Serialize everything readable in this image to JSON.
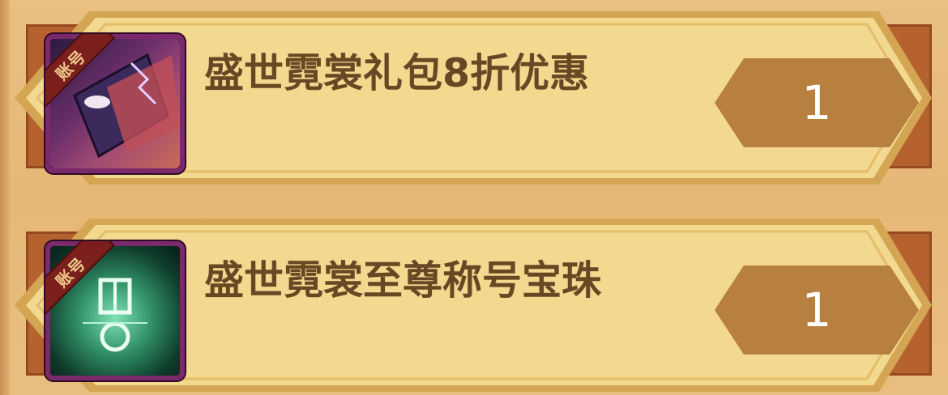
{
  "items": [
    {
      "tag": "账号",
      "name": "盛世霓裳礼包8折优惠",
      "icon": "discount-card-icon",
      "count": "1"
    },
    {
      "tag": "账号",
      "name": "盛世霓裳至尊称号宝珠",
      "icon": "title-orb-icon",
      "count": "1"
    }
  ],
  "colors": {
    "background": "#e8bc7e",
    "plate": "#f2d98f",
    "text": "#6a4724",
    "badge": "#b8803f",
    "tag": "#7a1f1c"
  }
}
